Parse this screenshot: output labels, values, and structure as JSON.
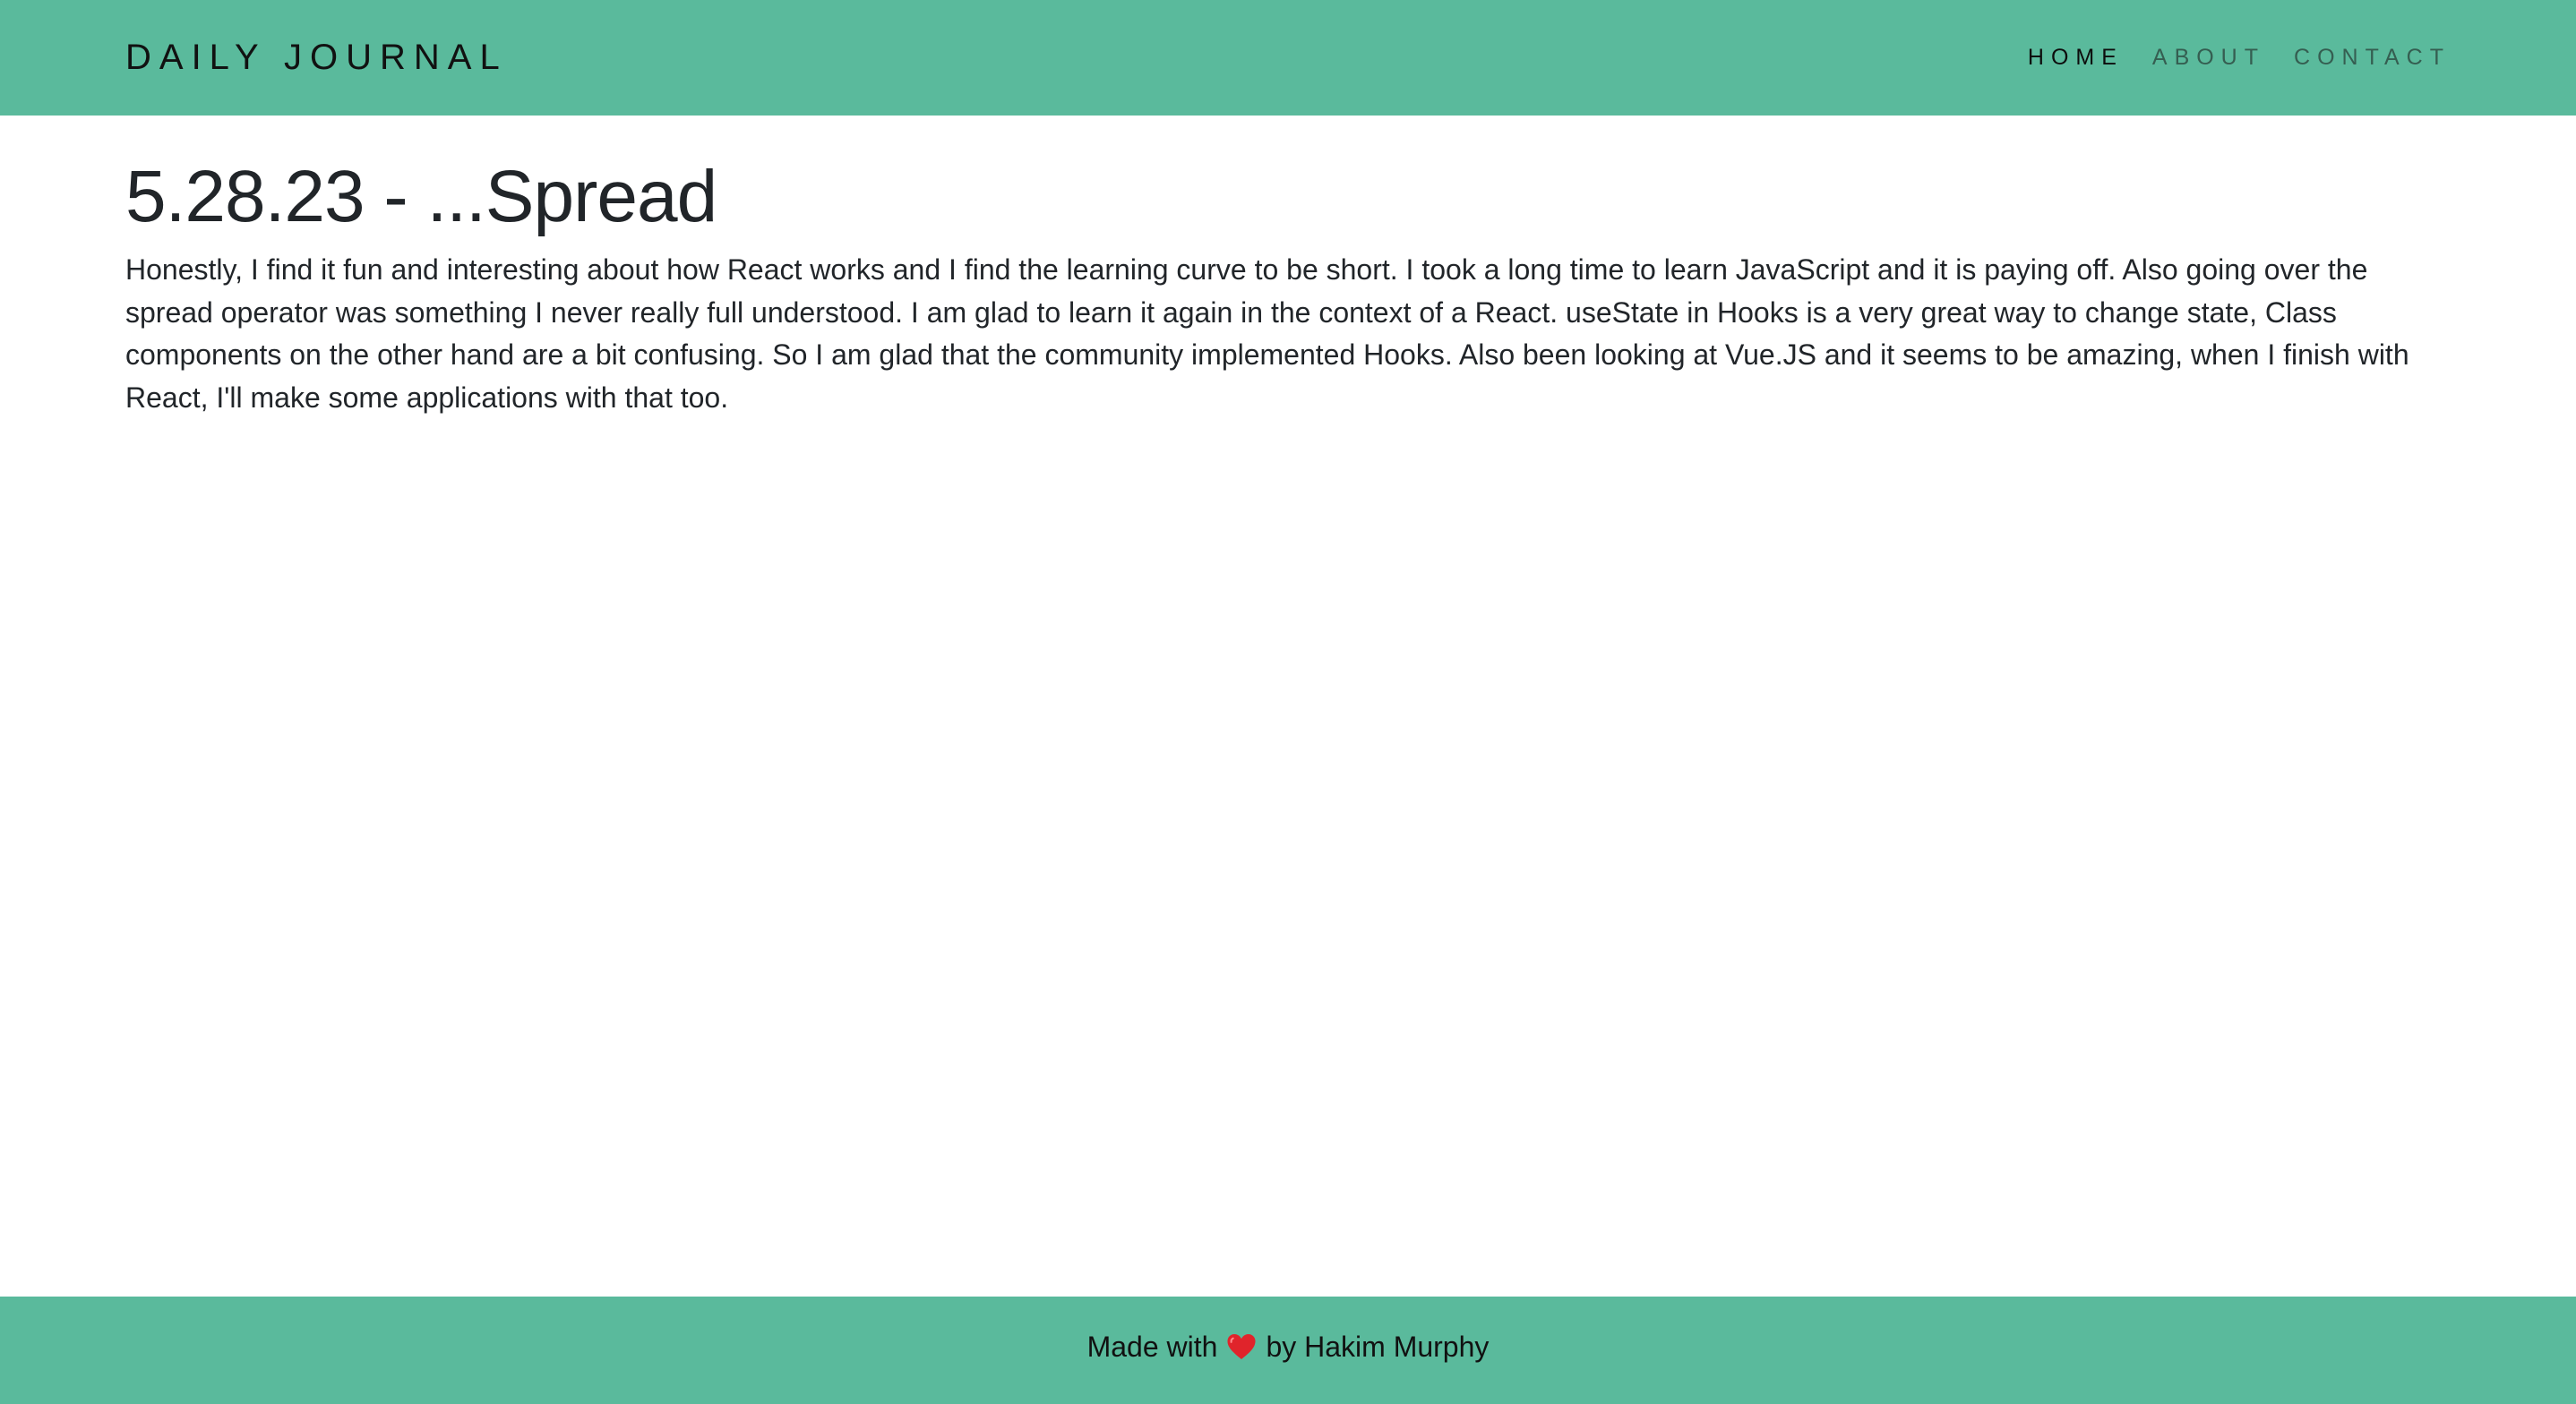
{
  "colors": {
    "header_background": "#5aba9c",
    "footer_background": "#5aba9c",
    "heart": "#e0242b",
    "text": "#212529"
  },
  "header": {
    "brand": "DAILY JOURNAL",
    "nav": [
      {
        "label": "HOME",
        "active": true
      },
      {
        "label": "ABOUT",
        "active": false
      },
      {
        "label": "CONTACT",
        "active": false
      }
    ]
  },
  "post": {
    "title": "5.28.23 - ...Spread",
    "body": "Honestly, I find it fun and interesting about how React works and I find the learning curve to be short. I took a long time to learn JavaScript and it is paying off. Also going over the spread operator was something I never really full understood. I am glad to learn it again in the context of a React. useState in Hooks is a very great way to change state, Class components on the other hand are a bit confusing. So I am glad that the community implemented Hooks. Also been looking at Vue.JS and it seems to be amazing, when I finish with React, I'll make some applications with that too."
  },
  "footer": {
    "made_with": "Made with",
    "heart_icon": "heart-icon",
    "by_author": "by Hakim Murphy"
  }
}
